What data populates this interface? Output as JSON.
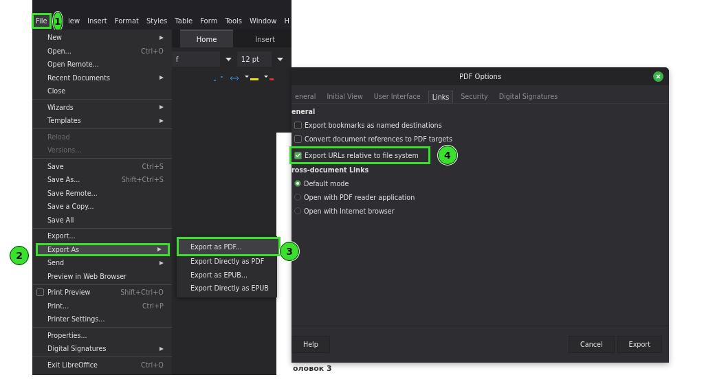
{
  "menu_bar": [
    {
      "label": "File",
      "highlighted": true,
      "badge": "1"
    },
    {
      "label": "iew"
    },
    {
      "label": "Insert"
    },
    {
      "label": "Format"
    },
    {
      "label": "Styles"
    },
    {
      "label": "Table"
    },
    {
      "label": "Form"
    },
    {
      "label": "Tools"
    },
    {
      "label": "Window"
    },
    {
      "label": "H"
    }
  ],
  "file_menu": [
    {
      "kind": "item",
      "label": "New",
      "submenu": true
    },
    {
      "kind": "item",
      "label": "Open...",
      "shortcut": "Ctrl+O"
    },
    {
      "kind": "item",
      "label": "Open Remote..."
    },
    {
      "kind": "item",
      "label": "Recent Documents",
      "submenu": true
    },
    {
      "kind": "item",
      "label": "Close"
    },
    {
      "kind": "separator"
    },
    {
      "kind": "item",
      "label": "Wizards",
      "submenu": true
    },
    {
      "kind": "item",
      "label": "Templates",
      "submenu": true
    },
    {
      "kind": "separator"
    },
    {
      "kind": "item",
      "label": "Reload",
      "disabled": true
    },
    {
      "kind": "item",
      "label": "Versions...",
      "disabled": true
    },
    {
      "kind": "separator"
    },
    {
      "kind": "item",
      "label": "Save",
      "shortcut": "Ctrl+S"
    },
    {
      "kind": "item",
      "label": "Save As...",
      "shortcut": "Shift+Ctrl+S"
    },
    {
      "kind": "item",
      "label": "Save Remote..."
    },
    {
      "kind": "item",
      "label": "Save a Copy..."
    },
    {
      "kind": "item",
      "label": "Save All"
    },
    {
      "kind": "separator"
    },
    {
      "kind": "item",
      "label": "Export..."
    },
    {
      "kind": "item",
      "label": "Export As",
      "submenu": true,
      "selected": true,
      "highlighted": true,
      "badge": "2"
    },
    {
      "kind": "item",
      "label": "Send",
      "submenu": true
    },
    {
      "kind": "item",
      "label": "Preview in Web Browser"
    },
    {
      "kind": "separator"
    },
    {
      "kind": "check",
      "label": "Print Preview",
      "shortcut": "Shift+Ctrl+O",
      "checked": false
    },
    {
      "kind": "item",
      "label": "Print...",
      "shortcut": "Ctrl+P"
    },
    {
      "kind": "item",
      "label": "Printer Settings..."
    },
    {
      "kind": "separator"
    },
    {
      "kind": "item",
      "label": "Properties..."
    },
    {
      "kind": "item",
      "label": "Digital Signatures",
      "submenu": true
    },
    {
      "kind": "separator"
    },
    {
      "kind": "item",
      "label": "Exit LibreOffice",
      "shortcut": "Ctrl+Q"
    }
  ],
  "export_submenu": [
    {
      "label": "Export as PDF...",
      "selected": true,
      "highlighted": true,
      "badge": "3"
    },
    {
      "label": "Export Directly as PDF",
      "selected": false
    },
    {
      "label": "Export as EPUB...",
      "selected": false
    },
    {
      "label": "Export Directly as EPUB",
      "selected": false
    }
  ],
  "ribbon": {
    "tabs": [
      {
        "label": "Home",
        "selected": true
      },
      {
        "label": "Insert",
        "selected": false
      }
    ],
    "font_name": "f",
    "font_size": "12 pt"
  },
  "document_text": "оловок 3",
  "dialog": {
    "title": "PDF Options",
    "tabs": [
      {
        "label": "eneral",
        "selected": false
      },
      {
        "label": "Initial View",
        "selected": false
      },
      {
        "label": "User Interface",
        "selected": false
      },
      {
        "label": "Links",
        "selected": true
      },
      {
        "label": "Security",
        "selected": false
      },
      {
        "label": "Digital Signatures",
        "selected": false
      }
    ],
    "sections": [
      {
        "heading": "eneral",
        "options": [
          {
            "kind": "checkbox",
            "label": "Export bookmarks as named destinations",
            "checked": false
          },
          {
            "kind": "checkbox",
            "label": "Convert document references to PDF targets",
            "checked": false
          },
          {
            "kind": "checkbox",
            "label": "Export URLs relative to file system",
            "checked": true,
            "highlighted": true,
            "badge": "4"
          }
        ]
      },
      {
        "heading": "ross-document Links",
        "options": [
          {
            "kind": "radio",
            "label": "Default mode",
            "selected": true
          },
          {
            "kind": "radio",
            "label": "Open with PDF reader application",
            "selected": false
          },
          {
            "kind": "radio",
            "label": "Open with Internet browser",
            "selected": false
          }
        ]
      }
    ],
    "buttons_left": [
      "Help"
    ],
    "buttons_right": [
      "Cancel",
      "Export"
    ]
  }
}
